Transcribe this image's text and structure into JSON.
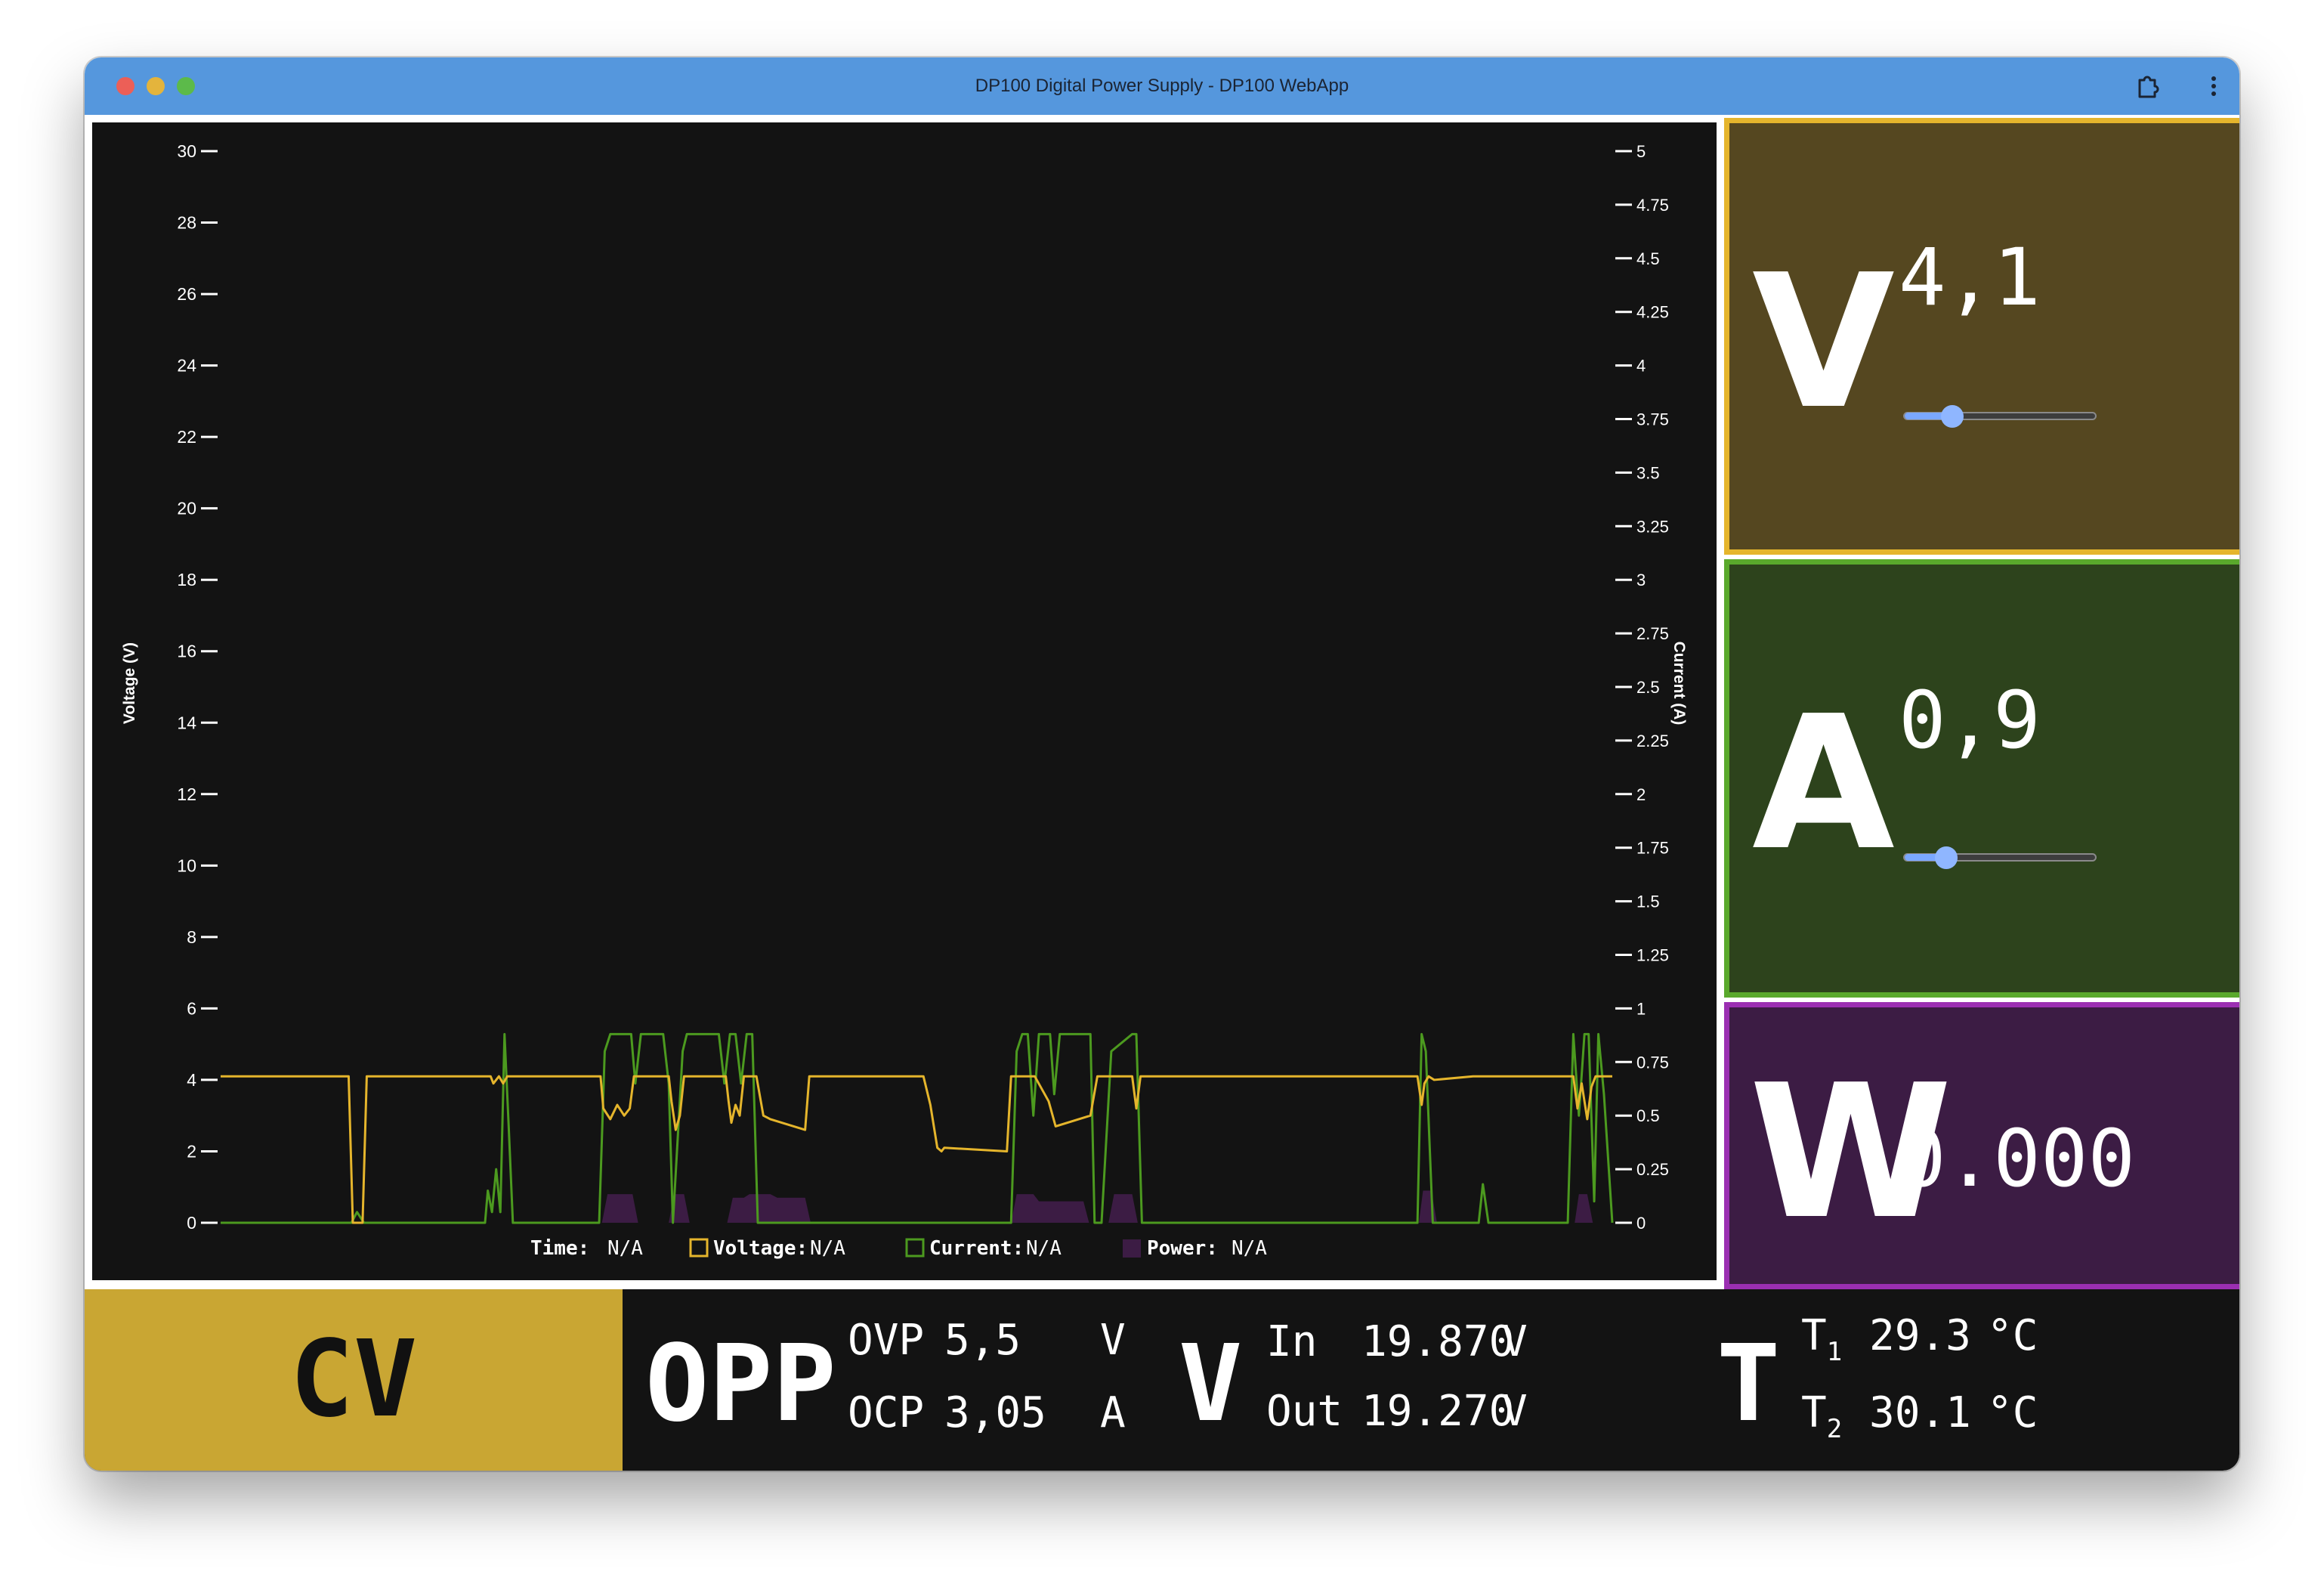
{
  "window": {
    "title": "DP100 Digital Power Supply - DP100 WebApp",
    "icons": [
      "extensions-icon",
      "kebab-menu-icon"
    ]
  },
  "chart_data": {
    "type": "line",
    "ylabel": "Voltage (V)",
    "y2label": "Current (A)",
    "ylim": [
      0,
      30
    ],
    "y2lim": [
      0,
      5
    ],
    "yticks": [
      "0",
      "2",
      "4",
      "6",
      "8",
      "10",
      "12",
      "14",
      "16",
      "18",
      "20",
      "22",
      "24",
      "26",
      "28",
      "30"
    ],
    "y2ticks": [
      "0",
      "0.25",
      "0.5",
      "0.75",
      "1",
      "1.25",
      "1.5",
      "1.75",
      "2",
      "2.25",
      "2.5",
      "2.75",
      "3",
      "3.25",
      "3.5",
      "3.75",
      "4",
      "4.25",
      "4.5",
      "4.75",
      "5"
    ],
    "colors": {
      "voltage": "#e5b52c",
      "current": "#4c9a1f",
      "power": "#3c1c44",
      "background": "#131313"
    },
    "legend": {
      "placement": "bottom",
      "items": [
        {
          "label": "Time:",
          "value": "N/A"
        },
        {
          "label": "Voltage:",
          "value": "N/A"
        },
        {
          "label": "Current:",
          "value": "N/A"
        },
        {
          "label": "Power:",
          "value": "N/A"
        }
      ]
    },
    "series": [
      {
        "name": "Voltage",
        "axis": "left",
        "x": [
          0,
          9.2,
          9.5,
          10.2,
          10.5,
          19.4,
          19.6,
          20.0,
          20.3,
          20.6,
          27.3,
          27.5,
          28.0,
          28.5,
          29.0,
          29.4,
          29.7,
          32.2,
          32.4,
          32.7,
          33.0,
          33.3,
          36.3,
          36.5,
          36.7,
          37.0,
          37.3,
          37.6,
          38.5,
          39.0,
          39.5,
          42.0,
          42.3,
          42.6,
          43.0,
          43.5,
          50.5,
          51.0,
          51.5,
          51.8,
          52.0,
          56.5,
          56.8,
          57.5,
          58.5,
          59.5,
          60.0,
          62.5,
          63.0,
          63.3,
          63.6,
          64.0,
          65.5,
          65.8,
          66.1,
          86.0,
          86.3,
          86.5,
          86.8,
          87.2,
          90,
          90.5,
          91,
          97.2,
          97.5,
          97.8,
          98.2,
          98.5,
          98.8,
          99.1,
          99.4,
          100
        ],
        "values": [
          4.1,
          4.1,
          0,
          0,
          4.1,
          4.1,
          3.9,
          4.1,
          3.9,
          4.1,
          4.1,
          3.2,
          2.9,
          3.3,
          3.0,
          3.2,
          4.1,
          4.1,
          3.4,
          2.6,
          3.0,
          4.1,
          4.1,
          3.4,
          2.8,
          3.3,
          3.0,
          4.1,
          4.1,
          3.0,
          2.9,
          2.6,
          4.1,
          4.1,
          4.1,
          4.1,
          4.1,
          3.3,
          2.1,
          2.0,
          2.1,
          2.0,
          4.1,
          4.1,
          4.1,
          3.4,
          2.7,
          3.0,
          4.1,
          4.1,
          4.1,
          4.1,
          4.1,
          3.2,
          4.1,
          4.1,
          3.3,
          3.9,
          4.1,
          4.0,
          4.1,
          4.1,
          4.1,
          4.1,
          3.2,
          3.9,
          2.9,
          3.8,
          4.1,
          4.1,
          4.1,
          4.1
        ]
      },
      {
        "name": "Current",
        "axis": "right",
        "x": [
          0,
          9.4,
          9.8,
          10.3,
          19.0,
          19.2,
          19.5,
          19.8,
          20.1,
          20.4,
          20.7,
          21.0,
          27.2,
          27.6,
          28.0,
          29.5,
          29.8,
          30.2,
          31.8,
          32.2,
          32.5,
          33.2,
          33.5,
          35.8,
          36.2,
          36.6,
          37.0,
          37.4,
          37.8,
          38.0,
          38.2,
          38.6,
          42.0,
          42.5,
          56.8,
          57.2,
          57.6,
          58.0,
          58.4,
          58.8,
          59.6,
          59.9,
          60.3,
          60.8,
          61.2,
          62.5,
          62.8,
          63.3,
          64.0,
          65.5,
          65.8,
          66.2,
          86.0,
          86.3,
          86.6,
          87.1,
          90.4,
          90.7,
          91.1,
          96.8,
          97.2,
          97.6,
          98.0,
          98.3,
          98.7,
          99.0,
          99.4,
          100
        ],
        "values": [
          0,
          0,
          0.05,
          0,
          0,
          0.15,
          0.05,
          0.25,
          0.05,
          0.88,
          0.45,
          0,
          0,
          0.8,
          0.88,
          0.88,
          0.65,
          0.88,
          0.88,
          0.65,
          0,
          0.8,
          0.88,
          0.88,
          0.65,
          0.88,
          0.88,
          0.65,
          0.88,
          0.88,
          0.88,
          0,
          0,
          0,
          0,
          0.8,
          0.88,
          0.88,
          0.5,
          0.88,
          0.88,
          0.6,
          0.88,
          0.88,
          0.88,
          0.88,
          0,
          0,
          0.8,
          0.88,
          0.88,
          0,
          0,
          0.88,
          0.8,
          0,
          0,
          0.18,
          0,
          0,
          0.88,
          0.5,
          0.88,
          0.88,
          0.1,
          0.88,
          0.6,
          0
        ]
      },
      {
        "name": "Power",
        "axis": "left",
        "x": [
          0,
          27.4,
          27.8,
          29.6,
          30.0,
          32.2,
          32.6,
          33.3,
          33.7,
          36.4,
          36.8,
          37.6,
          38.0,
          39.5,
          40.0,
          42.0,
          42.4,
          56.8,
          57.2,
          58.4,
          58.8,
          62.0,
          62.4,
          63.8,
          64.2,
          65.5,
          65.9,
          86.1,
          86.4,
          87.0,
          87.4,
          97.3,
          97.6,
          98.2,
          98.6,
          100
        ],
        "values": [
          0,
          0,
          0.8,
          0.8,
          0,
          0,
          0.8,
          0.8,
          0,
          0,
          0.7,
          0.7,
          0.8,
          0.8,
          0.7,
          0.7,
          0,
          0,
          0.8,
          0.8,
          0.6,
          0.6,
          0,
          0,
          0.8,
          0.8,
          0,
          0,
          0.9,
          0.9,
          0,
          0,
          0.8,
          0.8,
          0,
          0
        ]
      }
    ]
  },
  "controls": {
    "voltage": {
      "symbol": "V",
      "value": "4,1",
      "slider_fraction": 0.25
    },
    "current": {
      "symbol": "A",
      "value": "0,9",
      "slider_fraction": 0.22
    },
    "power": {
      "symbol": "W",
      "value": "0.000"
    }
  },
  "status": {
    "mode": "CV",
    "protection": "OPP",
    "ovp_label": "OVP",
    "ovp_value": "5,5",
    "ovp_unit": "V",
    "ocp_label": "OCP",
    "ocp_value": "3,05",
    "ocp_unit": "A",
    "voltage_symbol": "V",
    "in_label": "In",
    "in_value": "19.870",
    "in_unit": "V",
    "out_label": "Out",
    "out_value": "19.270",
    "out_unit": "V",
    "temp_symbol": "T",
    "t1_label": "T",
    "t1_sub": "1",
    "t1_value": "29.3",
    "t1_unit": "°C",
    "t2_label": "T",
    "t2_sub": "2",
    "t2_value": "30.1",
    "t2_unit": "°C"
  }
}
